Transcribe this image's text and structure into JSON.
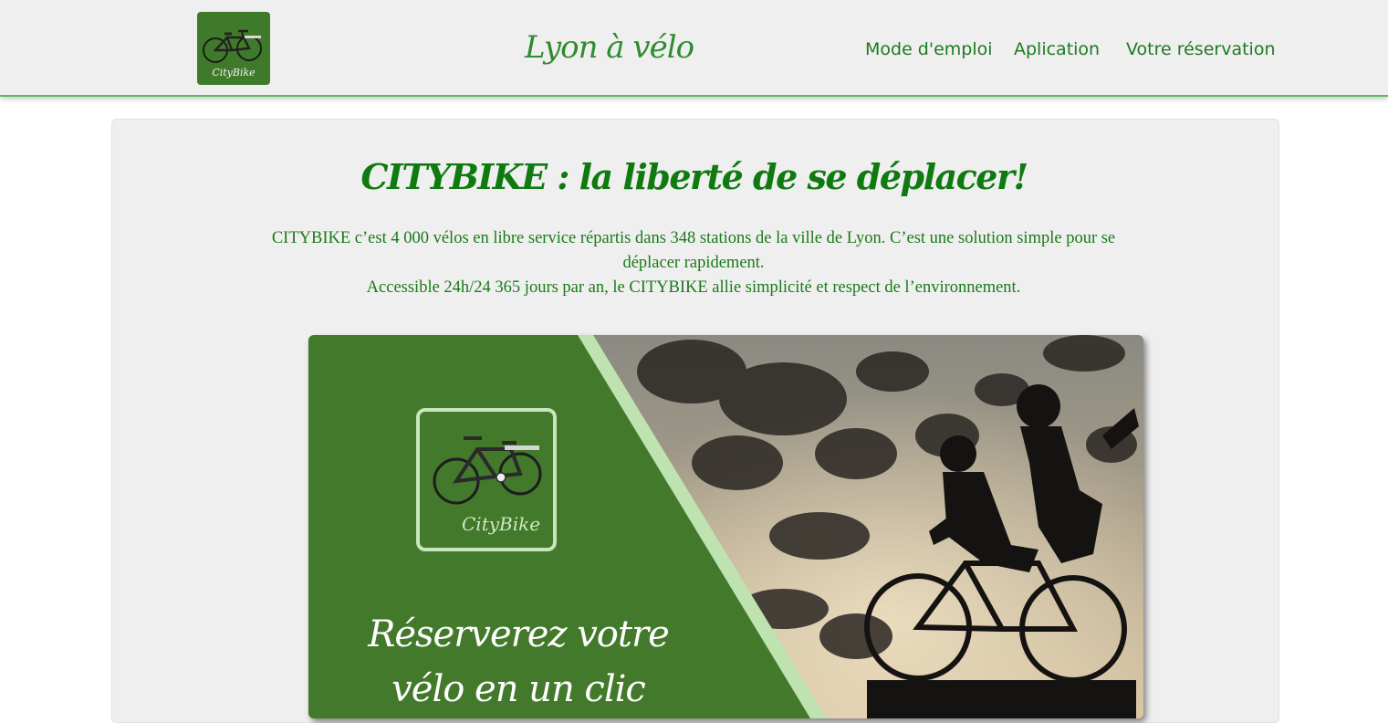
{
  "header": {
    "logo_text": "CityBike",
    "site_title": "Lyon à vélo",
    "nav": [
      {
        "label": "Mode d'emploi"
      },
      {
        "label": "Aplication"
      },
      {
        "label": "Votre réservation"
      }
    ]
  },
  "main": {
    "title": "CITYBIKE : la liberté de se déplacer!",
    "intro_line1": "CITYBIKE c’est 4 000 vélos en libre service répartis dans 348 stations de la ville de Lyon. C’est une solution simple pour se déplacer rapidement.",
    "intro_line2": "Accessible 24h/24 365 jours par an, le CITYBIKE allie simplicité et respect de l’environnement.",
    "banner": {
      "logo_text": "CityBike",
      "slogan_line1": "Réserverez votre",
      "slogan_line2": "vélo en un clic"
    }
  },
  "colors": {
    "brand_green": "#3f7a2b",
    "text_green": "#1a7a1a",
    "accent_light_green": "#bfe3b0",
    "header_bg": "#efefef"
  },
  "icons": [
    "bicycle-icon",
    "silhouette-photo"
  ]
}
